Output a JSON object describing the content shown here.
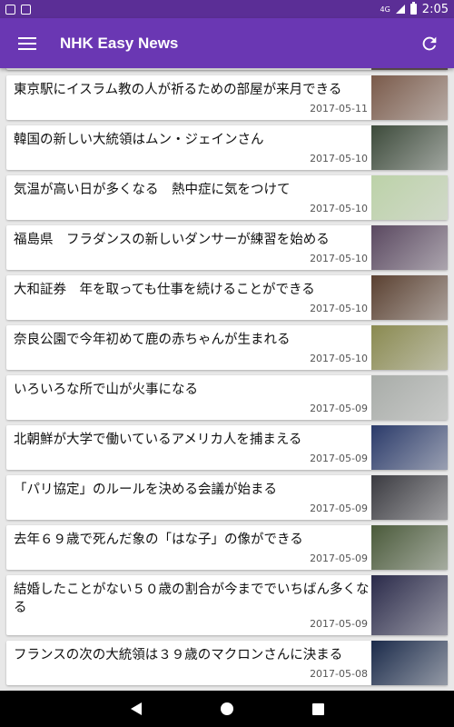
{
  "status": {
    "time": "2:05",
    "network": "4G"
  },
  "app": {
    "title": "NHK Easy News"
  },
  "articles": [
    {
      "title": "東京駅にイスラム教の人が祈るための部屋が来月できる",
      "date": "2017-05-11",
      "thumb_color": "#7a5a4a"
    },
    {
      "title": "韓国の新しい大統領はムン・ジェインさん",
      "date": "2017-05-10",
      "thumb_color": "#3c4a3a"
    },
    {
      "title": "気温が高い日が多くなる　熱中症に気をつけて",
      "date": "2017-05-10",
      "thumb_color": "#bcd2a8"
    },
    {
      "title": "福島県　フラダンスの新しいダンサーが練習を始める",
      "date": "2017-05-10",
      "thumb_color": "#5a4860"
    },
    {
      "title": "大和証券　年を取っても仕事を続けることができる",
      "date": "2017-05-10",
      "thumb_color": "#5a4030"
    },
    {
      "title": "奈良公園で今年初めて鹿の赤ちゃんが生まれる",
      "date": "2017-05-10",
      "thumb_color": "#8a8a50"
    },
    {
      "title": "いろいろな所で山が火事になる",
      "date": "2017-05-09",
      "thumb_color": "#a8aca8"
    },
    {
      "title": "北朝鮮が大学で働いているアメリカ人を捕まえる",
      "date": "2017-05-09",
      "thumb_color": "#2a3a6a"
    },
    {
      "title": "「パリ協定」のルールを決める会議が始まる",
      "date": "2017-05-09",
      "thumb_color": "#3a3a40"
    },
    {
      "title": "去年６９歳で死んだ象の「はな子」の像ができる",
      "date": "2017-05-09",
      "thumb_color": "#4a5a3a"
    },
    {
      "title": "結婚したことがない５０歳の割合が今まででいちばん多くなる",
      "date": "2017-05-09",
      "thumb_color": "#2a2a4a"
    },
    {
      "title": "フランスの次の大統領は３９歳のマクロンさんに決まる",
      "date": "2017-05-08",
      "thumb_color": "#1a2a4a"
    }
  ],
  "colors": {
    "status_bar": "#5b2e96",
    "app_bar": "#6a37b3",
    "background": "#e8e8e8"
  }
}
